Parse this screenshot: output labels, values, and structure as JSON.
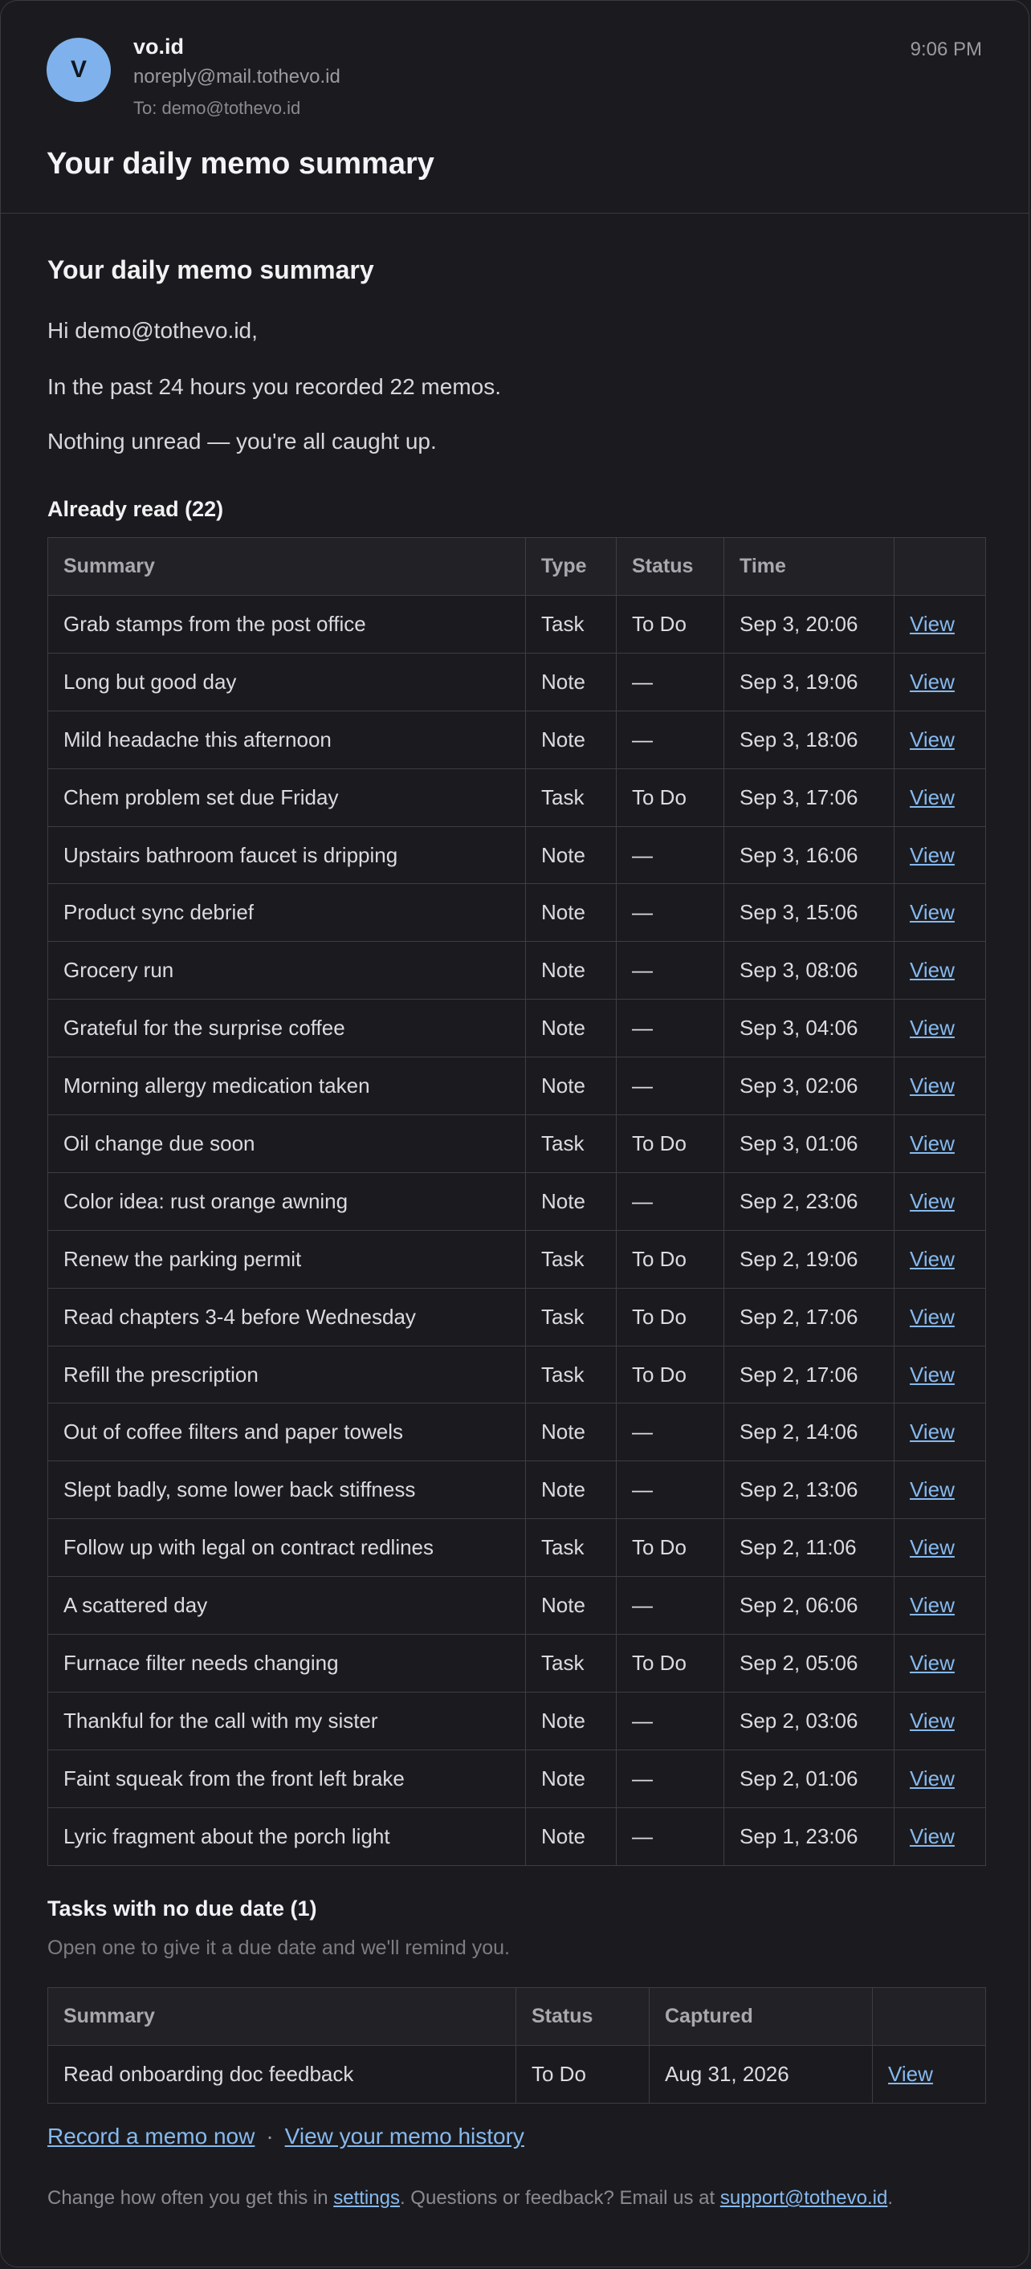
{
  "email": {
    "avatar_letter": "V",
    "sender_name": "vo.id",
    "sender_email": "noreply@mail.tothevo.id",
    "recipient": "To: demo@tothevo.id",
    "time": "9:06 PM",
    "subject": "Your daily memo summary"
  },
  "content": {
    "heading": "Your daily memo summary",
    "greeting": "Hi demo@tothevo.id,",
    "recorded": "In the past 24 hours you recorded 22 memos.",
    "unread": "Nothing unread — you're all caught up."
  },
  "already_read": {
    "title": "Already read (22)",
    "columns": [
      "Summary",
      "Type",
      "Status",
      "Time",
      ""
    ],
    "rows": [
      {
        "summary": "Grab stamps from the post office",
        "type": "Task",
        "status": "To Do",
        "time": "Sep 3, 20:06",
        "action": "View"
      },
      {
        "summary": "Long but good day",
        "type": "Note",
        "status": "—",
        "time": "Sep 3, 19:06",
        "action": "View"
      },
      {
        "summary": "Mild headache this afternoon",
        "type": "Note",
        "status": "—",
        "time": "Sep 3, 18:06",
        "action": "View"
      },
      {
        "summary": "Chem problem set due Friday",
        "type": "Task",
        "status": "To Do",
        "time": "Sep 3, 17:06",
        "action": "View"
      },
      {
        "summary": "Upstairs bathroom faucet is dripping",
        "type": "Note",
        "status": "—",
        "time": "Sep 3, 16:06",
        "action": "View"
      },
      {
        "summary": "Product sync debrief",
        "type": "Note",
        "status": "—",
        "time": "Sep 3, 15:06",
        "action": "View"
      },
      {
        "summary": "Grocery run",
        "type": "Note",
        "status": "—",
        "time": "Sep 3, 08:06",
        "action": "View"
      },
      {
        "summary": "Grateful for the surprise coffee",
        "type": "Note",
        "status": "—",
        "time": "Sep 3, 04:06",
        "action": "View"
      },
      {
        "summary": "Morning allergy medication taken",
        "type": "Note",
        "status": "—",
        "time": "Sep 3, 02:06",
        "action": "View"
      },
      {
        "summary": "Oil change due soon",
        "type": "Task",
        "status": "To Do",
        "time": "Sep 3, 01:06",
        "action": "View"
      },
      {
        "summary": "Color idea: rust orange awning",
        "type": "Note",
        "status": "—",
        "time": "Sep 2, 23:06",
        "action": "View"
      },
      {
        "summary": "Renew the parking permit",
        "type": "Task",
        "status": "To Do",
        "time": "Sep 2, 19:06",
        "action": "View"
      },
      {
        "summary": "Read chapters 3-4 before Wednesday",
        "type": "Task",
        "status": "To Do",
        "time": "Sep 2, 17:06",
        "action": "View"
      },
      {
        "summary": "Refill the prescription",
        "type": "Task",
        "status": "To Do",
        "time": "Sep 2, 17:06",
        "action": "View"
      },
      {
        "summary": "Out of coffee filters and paper towels",
        "type": "Note",
        "status": "—",
        "time": "Sep 2, 14:06",
        "action": "View"
      },
      {
        "summary": "Slept badly, some lower back stiffness",
        "type": "Note",
        "status": "—",
        "time": "Sep 2, 13:06",
        "action": "View"
      },
      {
        "summary": "Follow up with legal on contract redlines",
        "type": "Task",
        "status": "To Do",
        "time": "Sep 2, 11:06",
        "action": "View"
      },
      {
        "summary": "A scattered day",
        "type": "Note",
        "status": "—",
        "time": "Sep 2, 06:06",
        "action": "View"
      },
      {
        "summary": "Furnace filter needs changing",
        "type": "Task",
        "status": "To Do",
        "time": "Sep 2, 05:06",
        "action": "View"
      },
      {
        "summary": "Thankful for the call with my sister",
        "type": "Note",
        "status": "—",
        "time": "Sep 2, 03:06",
        "action": "View"
      },
      {
        "summary": "Faint squeak from the front left brake",
        "type": "Note",
        "status": "—",
        "time": "Sep 2, 01:06",
        "action": "View"
      },
      {
        "summary": "Lyric fragment about the porch light",
        "type": "Note",
        "status": "—",
        "time": "Sep 1, 23:06",
        "action": "View"
      }
    ]
  },
  "no_due_date": {
    "title": "Tasks with no due date (1)",
    "subtitle": "Open one to give it a due date and we'll remind you.",
    "columns": [
      "Summary",
      "Status",
      "Captured",
      ""
    ],
    "rows": [
      {
        "summary": "Read onboarding doc feedback",
        "status": "To Do",
        "captured": "Aug 31, 2026",
        "action": "View"
      }
    ]
  },
  "links": {
    "record": "Record a memo now",
    "separator": "·",
    "history": "View your memo history"
  },
  "footer": {
    "prefix": "Change how often you get this in ",
    "settings": "settings",
    "middle": ". Questions or feedback? Email us at ",
    "support": "support@tothevo.id",
    "suffix": "."
  },
  "colors": {
    "background": "#1b1b1f",
    "avatar": "#7fb2ec",
    "link": "#86b9ef",
    "border": "#3d3d42"
  }
}
